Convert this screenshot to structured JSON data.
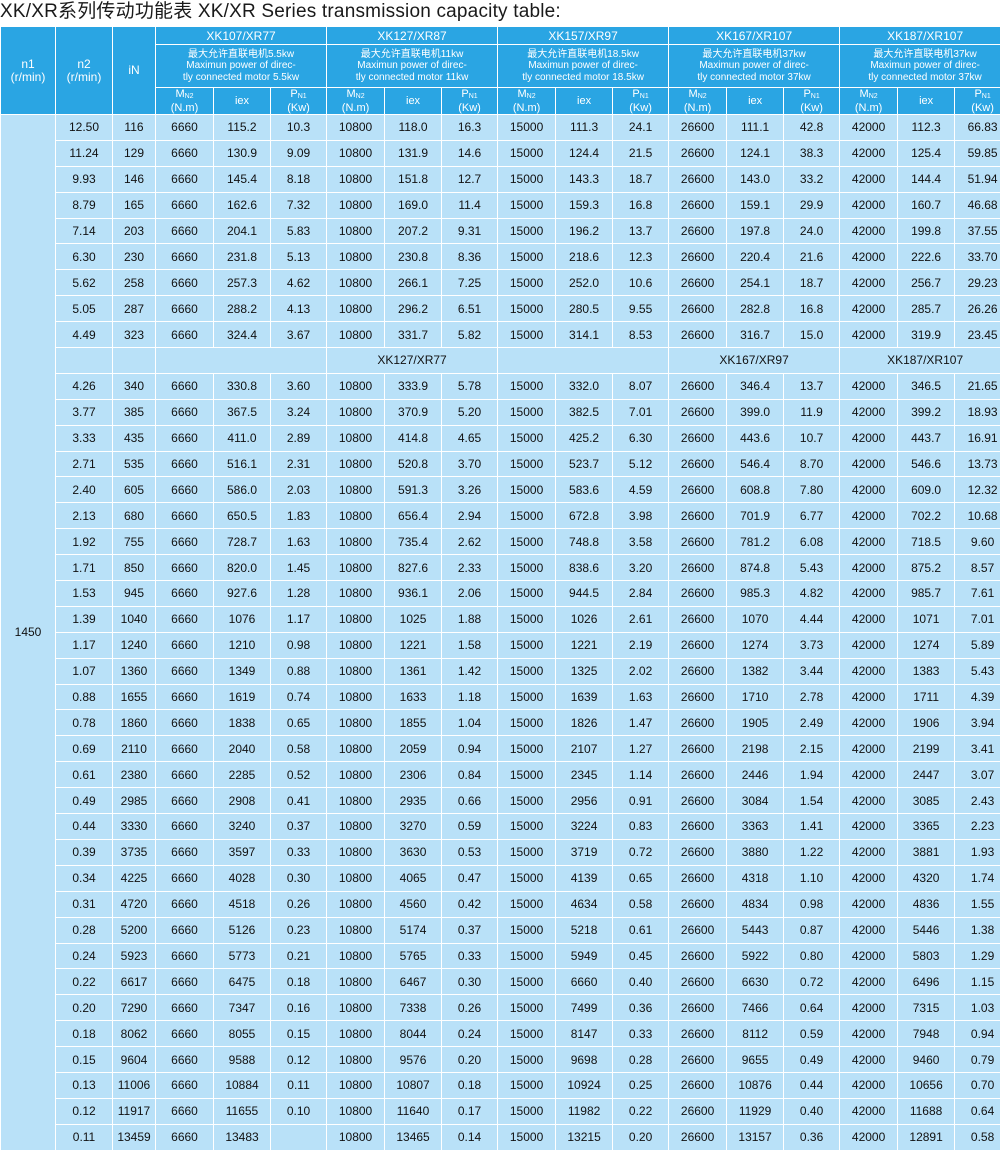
{
  "title": "XK/XR系列传动功能表  XK/XR Series transmission capacity table:",
  "header": {
    "n1": "n1",
    "n1_unit": "(r/min)",
    "n2": "n2",
    "n2_unit": "(r/min)",
    "iN": "iN",
    "groups": [
      {
        "model": "XK107/XR77",
        "desc": [
          "最大允许直联电机5.5kw",
          "Maximun power of direc-",
          "tly connected motor 5.5kw"
        ]
      },
      {
        "model": "XK127/XR87",
        "desc": [
          "最大允许直联电机11kw",
          "Maximun power of direc-",
          "tly connected motor 11kw"
        ]
      },
      {
        "model": "XK157/XR97",
        "desc": [
          "最大允许直联电机18.5kw",
          "Maximun power of direc-",
          "tly connected motor 18.5kw"
        ]
      },
      {
        "model": "XK167/XR107",
        "desc": [
          "最大允许直联电机37kw",
          "Maximun power of direc-",
          "tly connected motor 37kw"
        ]
      },
      {
        "model": "XK187/XR107",
        "desc": [
          "最大允许直联电机37kw",
          "Maximun power of direc-",
          "tly connected motor 37kw"
        ]
      }
    ],
    "sub": {
      "M": "M",
      "M_sub": "N2",
      "M_unit": "(N.m)",
      "iex": "iex",
      "P": "P",
      "P_sub": "N1",
      "P_unit": "(Kw)"
    }
  },
  "n1_value": "1450",
  "rows_a": [
    [
      "12.50",
      "116",
      "6660",
      "115.2",
      "10.3",
      "10800",
      "118.0",
      "16.3",
      "15000",
      "111.3",
      "24.1",
      "26600",
      "111.1",
      "42.8",
      "42000",
      "112.3",
      "66.83"
    ],
    [
      "11.24",
      "129",
      "6660",
      "130.9",
      "9.09",
      "10800",
      "131.9",
      "14.6",
      "15000",
      "124.4",
      "21.5",
      "26600",
      "124.1",
      "38.3",
      "42000",
      "125.4",
      "59.85"
    ],
    [
      "9.93",
      "146",
      "6660",
      "145.4",
      "8.18",
      "10800",
      "151.8",
      "12.7",
      "15000",
      "143.3",
      "18.7",
      "26600",
      "143.0",
      "33.2",
      "42000",
      "144.4",
      "51.94"
    ],
    [
      "8.79",
      "165",
      "6660",
      "162.6",
      "7.32",
      "10800",
      "169.0",
      "11.4",
      "15000",
      "159.3",
      "16.8",
      "26600",
      "159.1",
      "29.9",
      "42000",
      "160.7",
      "46.68"
    ],
    [
      "7.14",
      "203",
      "6660",
      "204.1",
      "5.83",
      "10800",
      "207.2",
      "9.31",
      "15000",
      "196.2",
      "13.7",
      "26600",
      "197.8",
      "24.0",
      "42000",
      "199.8",
      "37.55"
    ],
    [
      "6.30",
      "230",
      "6660",
      "231.8",
      "5.13",
      "10800",
      "230.8",
      "8.36",
      "15000",
      "218.6",
      "12.3",
      "26600",
      "220.4",
      "21.6",
      "42000",
      "222.6",
      "33.70"
    ],
    [
      "5.62",
      "258",
      "6660",
      "257.3",
      "4.62",
      "10800",
      "266.1",
      "7.25",
      "15000",
      "252.0",
      "10.6",
      "26600",
      "254.1",
      "18.7",
      "42000",
      "256.7",
      "29.23"
    ],
    [
      "5.05",
      "287",
      "6660",
      "288.2",
      "4.13",
      "10800",
      "296.2",
      "6.51",
      "15000",
      "280.5",
      "9.55",
      "26600",
      "282.8",
      "16.8",
      "42000",
      "285.7",
      "26.26"
    ],
    [
      "4.49",
      "323",
      "6660",
      "324.4",
      "3.67",
      "10800",
      "331.7",
      "5.82",
      "15000",
      "314.1",
      "8.53",
      "26600",
      "316.7",
      "15.0",
      "42000",
      "319.9",
      "23.45"
    ]
  ],
  "subheader": [
    "",
    "XK127/XR77",
    "",
    "XK167/XR97",
    "XK187/XR107"
  ],
  "rows_b": [
    [
      "4.26",
      "340",
      "6660",
      "330.8",
      "3.60",
      "10800",
      "333.9",
      "5.78",
      "15000",
      "332.0",
      "8.07",
      "26600",
      "346.4",
      "13.7",
      "42000",
      "346.5",
      "21.65"
    ],
    [
      "3.77",
      "385",
      "6660",
      "367.5",
      "3.24",
      "10800",
      "370.9",
      "5.20",
      "15000",
      "382.5",
      "7.01",
      "26600",
      "399.0",
      "11.9",
      "42000",
      "399.2",
      "18.93"
    ],
    [
      "3.33",
      "435",
      "6660",
      "411.0",
      "2.89",
      "10800",
      "414.8",
      "4.65",
      "15000",
      "425.2",
      "6.30",
      "26600",
      "443.6",
      "10.7",
      "42000",
      "443.7",
      "16.91"
    ],
    [
      "2.71",
      "535",
      "6660",
      "516.1",
      "2.31",
      "10800",
      "520.8",
      "3.70",
      "15000",
      "523.7",
      "5.12",
      "26600",
      "546.4",
      "8.70",
      "42000",
      "546.6",
      "13.73"
    ],
    [
      "2.40",
      "605",
      "6660",
      "586.0",
      "2.03",
      "10800",
      "591.3",
      "3.26",
      "15000",
      "583.6",
      "4.59",
      "26600",
      "608.8",
      "7.80",
      "42000",
      "609.0",
      "12.32"
    ],
    [
      "2.13",
      "680",
      "6660",
      "650.5",
      "1.83",
      "10800",
      "656.4",
      "2.94",
      "15000",
      "672.8",
      "3.98",
      "26600",
      "701.9",
      "6.77",
      "42000",
      "702.2",
      "10.68"
    ],
    [
      "1.92",
      "755",
      "6660",
      "728.7",
      "1.63",
      "10800",
      "735.4",
      "2.62",
      "15000",
      "748.8",
      "3.58",
      "26600",
      "781.2",
      "6.08",
      "42000",
      "718.5",
      "9.60"
    ],
    [
      "1.71",
      "850",
      "6660",
      "820.0",
      "1.45",
      "10800",
      "827.6",
      "2.33",
      "15000",
      "838.6",
      "3.20",
      "26600",
      "874.8",
      "5.43",
      "42000",
      "875.2",
      "8.57"
    ],
    [
      "1.53",
      "945",
      "6660",
      "927.6",
      "1.28",
      "10800",
      "936.1",
      "2.06",
      "15000",
      "944.5",
      "2.84",
      "26600",
      "985.3",
      "4.82",
      "42000",
      "985.7",
      "7.61"
    ],
    [
      "1.39",
      "1040",
      "6660",
      "1076",
      "1.17",
      "10800",
      "1025",
      "1.88",
      "15000",
      "1026",
      "2.61",
      "26600",
      "1070",
      "4.44",
      "42000",
      "1071",
      "7.01"
    ],
    [
      "1.17",
      "1240",
      "6660",
      "1210",
      "0.98",
      "10800",
      "1221",
      "1.58",
      "15000",
      "1221",
      "2.19",
      "26600",
      "1274",
      "3.73",
      "42000",
      "1274",
      "5.89"
    ],
    [
      "1.07",
      "1360",
      "6660",
      "1349",
      "0.88",
      "10800",
      "1361",
      "1.42",
      "15000",
      "1325",
      "2.02",
      "26600",
      "1382",
      "3.44",
      "42000",
      "1383",
      "5.43"
    ],
    [
      "0.88",
      "1655",
      "6660",
      "1619",
      "0.74",
      "10800",
      "1633",
      "1.18",
      "15000",
      "1639",
      "1.63",
      "26600",
      "1710",
      "2.78",
      "42000",
      "1711",
      "4.39"
    ],
    [
      "0.78",
      "1860",
      "6660",
      "1838",
      "0.65",
      "10800",
      "1855",
      "1.04",
      "15000",
      "1826",
      "1.47",
      "26600",
      "1905",
      "2.49",
      "42000",
      "1906",
      "3.94"
    ],
    [
      "0.69",
      "2110",
      "6660",
      "2040",
      "0.58",
      "10800",
      "2059",
      "0.94",
      "15000",
      "2107",
      "1.27",
      "26600",
      "2198",
      "2.15",
      "42000",
      "2199",
      "3.41"
    ],
    [
      "0.61",
      "2380",
      "6660",
      "2285",
      "0.52",
      "10800",
      "2306",
      "0.84",
      "15000",
      "2345",
      "1.14",
      "26600",
      "2446",
      "1.94",
      "42000",
      "2447",
      "3.07"
    ],
    [
      "0.49",
      "2985",
      "6660",
      "2908",
      "0.41",
      "10800",
      "2935",
      "0.66",
      "15000",
      "2956",
      "0.91",
      "26600",
      "3084",
      "1.54",
      "42000",
      "3085",
      "2.43"
    ],
    [
      "0.44",
      "3330",
      "6660",
      "3240",
      "0.37",
      "10800",
      "3270",
      "0.59",
      "15000",
      "3224",
      "0.83",
      "26600",
      "3363",
      "1.41",
      "42000",
      "3365",
      "2.23"
    ],
    [
      "0.39",
      "3735",
      "6660",
      "3597",
      "0.33",
      "10800",
      "3630",
      "0.53",
      "15000",
      "3719",
      "0.72",
      "26600",
      "3880",
      "1.22",
      "42000",
      "3881",
      "1.93"
    ],
    [
      "0.34",
      "4225",
      "6660",
      "4028",
      "0.30",
      "10800",
      "4065",
      "0.47",
      "15000",
      "4139",
      "0.65",
      "26600",
      "4318",
      "1.10",
      "42000",
      "4320",
      "1.74"
    ],
    [
      "0.31",
      "4720",
      "6660",
      "4518",
      "0.26",
      "10800",
      "4560",
      "0.42",
      "15000",
      "4634",
      "0.58",
      "26600",
      "4834",
      "0.98",
      "42000",
      "4836",
      "1.55"
    ],
    [
      "0.28",
      "5200",
      "6660",
      "5126",
      "0.23",
      "10800",
      "5174",
      "0.37",
      "15000",
      "5218",
      "0.61",
      "26600",
      "5443",
      "0.87",
      "42000",
      "5446",
      "1.38"
    ],
    [
      "0.24",
      "5923",
      "6660",
      "5773",
      "0.21",
      "10800",
      "5765",
      "0.33",
      "15000",
      "5949",
      "0.45",
      "26600",
      "5922",
      "0.80",
      "42000",
      "5803",
      "1.29"
    ],
    [
      "0.22",
      "6617",
      "6660",
      "6475",
      "0.18",
      "10800",
      "6467",
      "0.30",
      "15000",
      "6660",
      "0.40",
      "26600",
      "6630",
      "0.72",
      "42000",
      "6496",
      "1.15"
    ],
    [
      "0.20",
      "7290",
      "6660",
      "7347",
      "0.16",
      "10800",
      "7338",
      "0.26",
      "15000",
      "7499",
      "0.36",
      "26600",
      "7466",
      "0.64",
      "42000",
      "7315",
      "1.03"
    ],
    [
      "0.18",
      "8062",
      "6660",
      "8055",
      "0.15",
      "10800",
      "8044",
      "0.24",
      "15000",
      "8147",
      "0.33",
      "26600",
      "8112",
      "0.59",
      "42000",
      "7948",
      "0.94"
    ],
    [
      "0.15",
      "9604",
      "6660",
      "9588",
      "0.12",
      "10800",
      "9576",
      "0.20",
      "15000",
      "9698",
      "0.28",
      "26600",
      "9655",
      "0.49",
      "42000",
      "9460",
      "0.79"
    ],
    [
      "0.13",
      "11006",
      "6660",
      "10884",
      "0.11",
      "10800",
      "10807",
      "0.18",
      "15000",
      "10924",
      "0.25",
      "26600",
      "10876",
      "0.44",
      "42000",
      "10656",
      "0.70"
    ],
    [
      "0.12",
      "11917",
      "6660",
      "11655",
      "0.10",
      "10800",
      "11640",
      "0.17",
      "15000",
      "11982",
      "0.22",
      "26600",
      "11929",
      "0.40",
      "42000",
      "11688",
      "0.64"
    ],
    [
      "0.11",
      "13459",
      "6660",
      "13483",
      "",
      "10800",
      "13465",
      "0.14",
      "15000",
      "13215",
      "0.20",
      "26600",
      "13157",
      "0.36",
      "42000",
      "12891",
      "0.58"
    ]
  ]
}
